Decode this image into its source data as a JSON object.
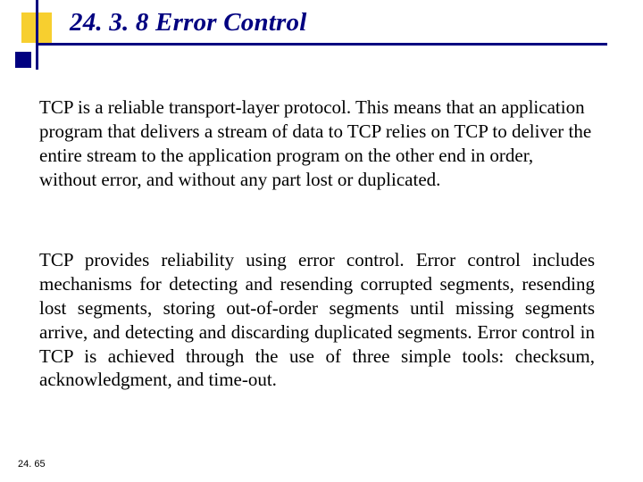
{
  "heading": "24. 3. 8  Error Control",
  "para1": "TCP is a reliable transport-layer protocol. This means that an application program that delivers a stream of data to TCP relies on TCP to deliver the entire stream to the application program on the other end in order, without error, and without any part lost or duplicated.",
  "para2": "TCP provides reliability using error control. Error control includes mechanisms for detecting and resending corrupted segments, resending lost segments, storing out-of-order segments until missing segments arrive, and detecting and discarding duplicated segments. Error control in TCP is achieved through the use of three simple tools: checksum, acknowledgment, and time-out.",
  "pagenum": "24. 65"
}
